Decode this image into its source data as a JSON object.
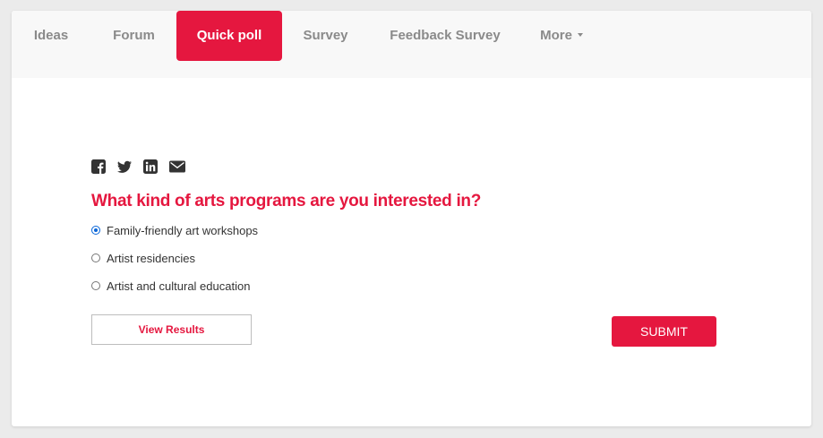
{
  "nav": {
    "tabs": [
      {
        "label": "Ideas"
      },
      {
        "label": "Forum"
      },
      {
        "label": "Quick poll"
      },
      {
        "label": "Survey"
      },
      {
        "label": "Feedback Survey"
      },
      {
        "label": "More"
      }
    ],
    "active_tab": "Quick poll"
  },
  "share": {
    "icons": [
      "facebook-icon",
      "twitter-icon",
      "linkedin-icon",
      "email-icon"
    ]
  },
  "poll": {
    "question": "What kind of arts programs are you interested in?",
    "options": [
      {
        "label": "Family-friendly art workshops",
        "selected": true
      },
      {
        "label": "Artist residencies",
        "selected": false
      },
      {
        "label": "Artist and cultural education",
        "selected": false
      }
    ],
    "view_results_label": "View Results",
    "submit_label": "SUBMIT"
  },
  "colors": {
    "accent": "#e5173f",
    "tab_text": "#8a8a8a",
    "tabbar_bg": "#f8f8f8",
    "radio_selected": "#0a66d8"
  }
}
